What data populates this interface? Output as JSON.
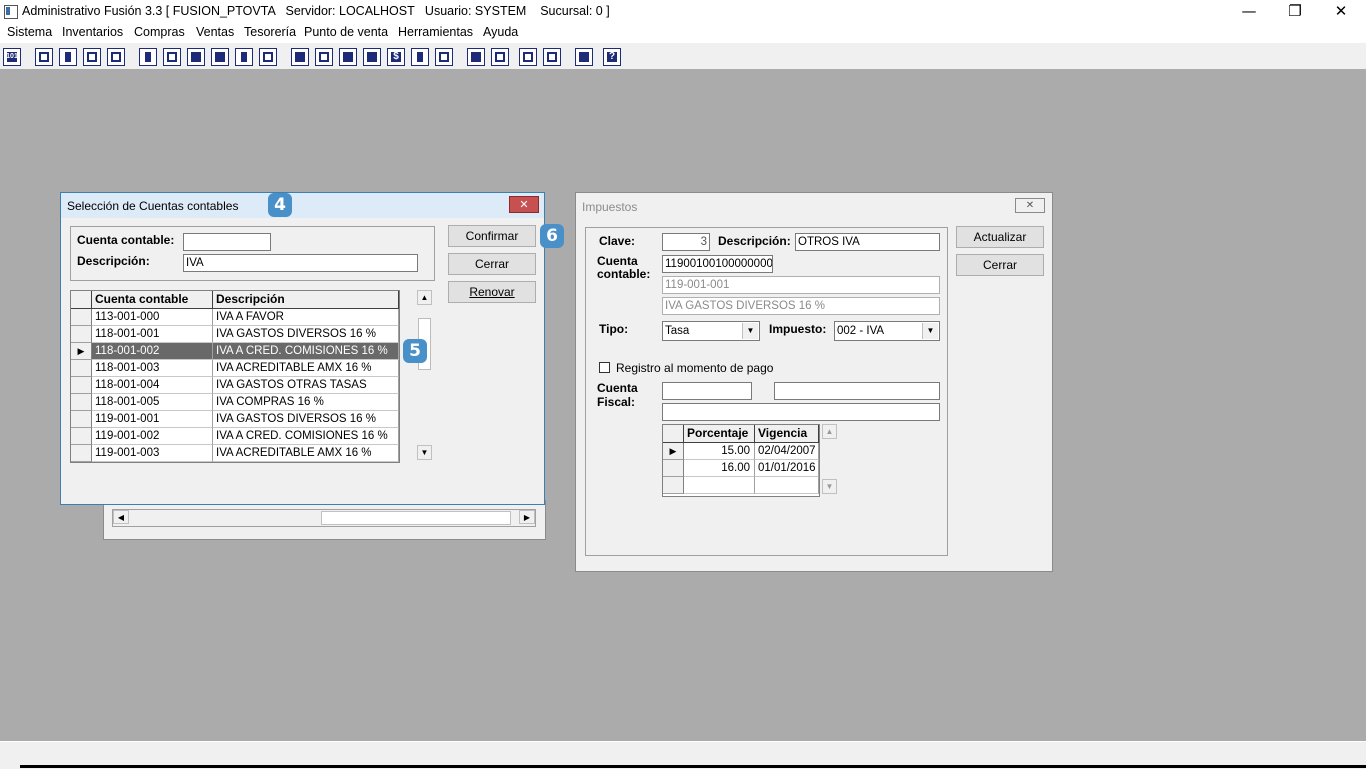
{
  "window": {
    "title": "Administrativo Fusión 3.3 [ FUSION_PTOVTA   Servidor: LOCALHOST   Usuario: SYSTEM    Sucursal: 0 ]",
    "minimize": "—",
    "maximize": "❐",
    "close": "✕"
  },
  "menu": [
    "Sistema",
    "Inventarios",
    "Compras",
    "Ventas",
    "Tesorería",
    "Punto de venta",
    "Herramientas",
    "Ayuda"
  ],
  "toolbar": {
    "icons": [
      "calculator-icon",
      "copy-icon",
      "clipboard-icon",
      "exchange-icon",
      "zoom-icon",
      "user-icon",
      "folder-icon",
      "cut-icon",
      "print-icon",
      "document-icon",
      "grid-icon",
      "binoculars-icon",
      "folder-open-icon",
      "export-icon",
      "add-icon",
      "dollar-icon",
      "report-icon",
      "list-icon",
      "home-icon",
      "search-icon",
      "refresh-icon",
      "undo-icon",
      "back-icon",
      "help-icon"
    ],
    "first_glyph": "101",
    "help_glyph": "?",
    "dollar_glyph": "$"
  },
  "seleccion": {
    "title": "Selección de Cuentas contables",
    "close_glyph": "✕",
    "cuenta_label": "Cuenta contable:",
    "cuenta_value": "",
    "descripcion_label": "Descripción:",
    "descripcion_value": "IVA",
    "confirmar": "Confirmar",
    "cerrar": "Cerrar",
    "renovar": "Renovar",
    "columns": [
      "Cuenta contable",
      "Descripción"
    ],
    "rows": [
      {
        "cuenta": "113-001-000",
        "desc": "IVA A FAVOR"
      },
      {
        "cuenta": "118-001-001",
        "desc": "IVA GASTOS DIVERSOS 16 %"
      },
      {
        "cuenta": "118-001-002",
        "desc": "IVA A CRED. COMISIONES 16 %"
      },
      {
        "cuenta": "118-001-003",
        "desc": "IVA ACREDITABLE AMX 16 %"
      },
      {
        "cuenta": "118-001-004",
        "desc": "IVA GASTOS OTRAS TASAS"
      },
      {
        "cuenta": "118-001-005",
        "desc": "IVA COMPRAS 16 %"
      },
      {
        "cuenta": "119-001-001",
        "desc": "IVA GASTOS DIVERSOS 16 %"
      },
      {
        "cuenta": "119-001-002",
        "desc": "IVA A CRED. COMISIONES 16 %"
      },
      {
        "cuenta": "119-001-003",
        "desc": "IVA ACREDITABLE AMX 16 %"
      }
    ],
    "selected_marker": "▶",
    "badge_title": "4",
    "badge_row": "5",
    "badge_confirm": "6"
  },
  "impuestos": {
    "title": "Impuestos",
    "close_glyph": "✕",
    "clave_label": "Clave:",
    "clave_value": "3",
    "descripcion_label": "Descripción:",
    "descripcion_value": "OTROS IVA",
    "cuenta_label_1": "Cuenta",
    "cuenta_label_2": "contable:",
    "cuenta_value": "11900100100000000",
    "cuenta_formatted": "119-001-001",
    "cuenta_desc": "IVA GASTOS DIVERSOS 16 %",
    "tipo_label": "Tipo:",
    "tipo_value": "Tasa",
    "impuesto_label": "Impuesto:",
    "impuesto_value": "002 - IVA",
    "registro_label": "Registro al momento de pago",
    "fiscal_label_1": "Cuenta",
    "fiscal_label_2": "Fiscal:",
    "actualizar": "Actualizar",
    "cerrar": "Cerrar",
    "columns": [
      "Porcentaje",
      "Vigencia"
    ],
    "rows": [
      {
        "porcentaje": "15.00",
        "vigencia": "02/04/2007"
      },
      {
        "porcentaje": "16.00",
        "vigencia": "01/01/2016"
      },
      {
        "porcentaje": "",
        "vigencia": ""
      }
    ],
    "selected_marker": "▶"
  }
}
